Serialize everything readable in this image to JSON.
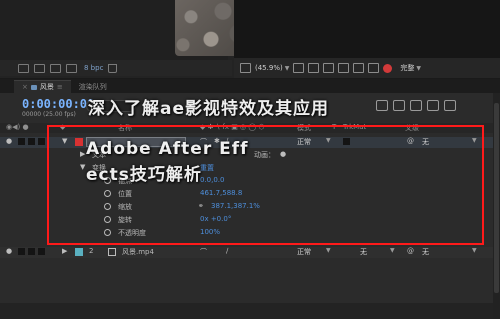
{
  "project_panel": {
    "bpc_label": "8 bpc"
  },
  "viewer": {
    "zoom": "(45.9%)",
    "quality": "完整"
  },
  "timeline": {
    "tabs": [
      {
        "label": "风景"
      },
      {
        "label": "渲染队列"
      }
    ],
    "timecode": "0:00:00:00",
    "fps_label": "00000 (25.00 fps)",
    "search_placeholder": "ρ▾",
    "columns": {
      "source_name": "名称",
      "mode": "模式",
      "trkmat": "TrkMat",
      "parent": "父级"
    },
    "layer1": {
      "index": "1",
      "name": "",
      "mode": "正常",
      "parent": "无"
    },
    "text_group": {
      "label": "文本",
      "animate": "动画："
    },
    "transform_group": {
      "label": "变换"
    },
    "properties": [
      {
        "name": "锚点",
        "value": "0.0,0.0"
      },
      {
        "name": "位置",
        "value": "461.7,588.8"
      },
      {
        "name": "缩放",
        "value": "387.1,387.1%"
      },
      {
        "name": "旋转",
        "value": "0x +0.0°"
      },
      {
        "name": "不透明度",
        "value": "100%"
      }
    ],
    "layer2": {
      "index": "2",
      "name": "风景.mp4",
      "mode": "正常",
      "trkmat": "无",
      "parent": "无"
    }
  },
  "watermark": {
    "line1": "深入了解ae影视特效及其应用",
    "line2": "Adobe After Eff",
    "line3": "ects技巧解析"
  },
  "colors": {
    "accent_blue": "#7ab4ff",
    "highlight_red": "#ff1a1a",
    "layer1_label": "#d83232",
    "layer2_label": "#5ab0c0"
  }
}
